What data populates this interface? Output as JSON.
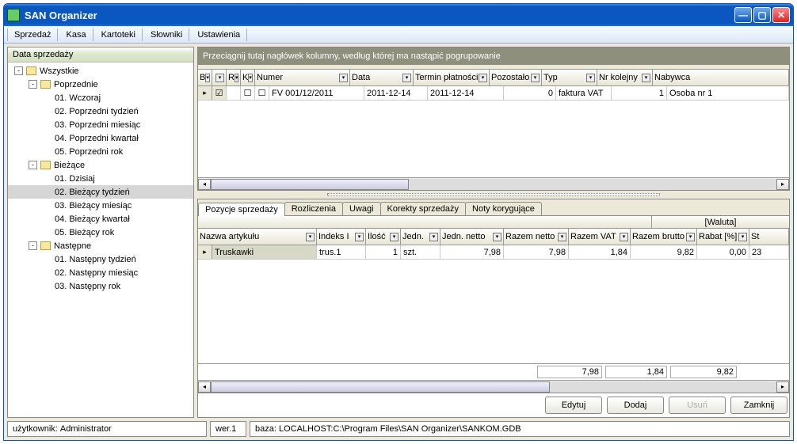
{
  "window": {
    "title": "SAN Organizer"
  },
  "menu": {
    "items": [
      "Sprzedaż",
      "Kasa",
      "Kartoteki",
      "Słowniki",
      "Ustawienia"
    ]
  },
  "sidebar": {
    "title": "Data sprzedaży",
    "tree": [
      {
        "level": 0,
        "expand": "-",
        "folder": true,
        "label": "Wszystkie"
      },
      {
        "level": 1,
        "expand": "-",
        "folder": true,
        "label": "Poprzednie"
      },
      {
        "level": 2,
        "label": "01. Wczoraj"
      },
      {
        "level": 2,
        "label": "02. Poprzedni tydzień"
      },
      {
        "level": 2,
        "label": "03. Poprzedni miesiąc"
      },
      {
        "level": 2,
        "label": "04. Poprzedni kwartał"
      },
      {
        "level": 2,
        "label": "05. Poprzedni rok"
      },
      {
        "level": 1,
        "expand": "-",
        "folder": true,
        "label": "Bieżące"
      },
      {
        "level": 2,
        "label": "01. Dzisiaj"
      },
      {
        "level": 2,
        "label": "02. Bieżący tydzień",
        "selected": true
      },
      {
        "level": 2,
        "label": "03. Bieżący miesiąc"
      },
      {
        "level": 2,
        "label": "04. Bieżący kwartał"
      },
      {
        "level": 2,
        "label": "05. Bieżący rok"
      },
      {
        "level": 1,
        "expand": "-",
        "folder": true,
        "label": "Następne"
      },
      {
        "level": 2,
        "label": "01. Następny tydzień"
      },
      {
        "level": 2,
        "label": "02. Następny miesiąc"
      },
      {
        "level": 2,
        "label": "03. Następny rok"
      }
    ]
  },
  "top_grid": {
    "group_hint": "Przeciągnij tutaj nagłówek kolumny, według której ma nastąpić pogrupowanie",
    "headers": [
      "B",
      "",
      "R",
      "K",
      "Numer",
      "Data",
      "Termin płatności",
      "Pozostało",
      "Typ",
      "Nr kolejny",
      "Nabywca"
    ],
    "row": {
      "b_checked": true,
      "r_checked": false,
      "k_checked": false,
      "numer": "FV 001/12/2011",
      "data": "2011-12-14",
      "termin": "2011-12-14",
      "pozostalo": "0",
      "typ": "faktura VAT",
      "nr": "1",
      "nabywca": "Osoba nr 1"
    }
  },
  "tabs": {
    "items": [
      "Pozycje sprzedaży",
      "Rozliczenia",
      "Uwagi",
      "Korekty sprzedaży",
      "Noty korygujące"
    ],
    "active": 0
  },
  "items_grid": {
    "waluta": "[Waluta]",
    "headers": [
      "Nazwa artykułu",
      "Indeks I",
      "Ilość",
      "Jedn.",
      "Jedn. netto",
      "Razem netto",
      "Razem VAT",
      "Razem brutto",
      "Rabat [%]",
      "St"
    ],
    "row": {
      "nazwa": "Truskawki",
      "indeks": "trus.1",
      "ilosc": "1",
      "jedn": "szt.",
      "jnetto": "7,98",
      "rnetto": "7,98",
      "rvat": "1,84",
      "rbrutto": "9,82",
      "rabat": "0,00",
      "st": "23"
    },
    "totals": {
      "netto": "7,98",
      "vat": "1,84",
      "brutto": "9,82"
    }
  },
  "buttons": {
    "edit": "Edytuj",
    "add": "Dodaj",
    "del": "Usuń",
    "close": "Zamknij"
  },
  "status": {
    "user_label": "użytkownik:",
    "user": "Administrator",
    "ver": "wer.1",
    "base_label": "baza:",
    "base": "LOCALHOST:C:\\Program Files\\SAN Organizer\\SANKOM.GDB"
  }
}
